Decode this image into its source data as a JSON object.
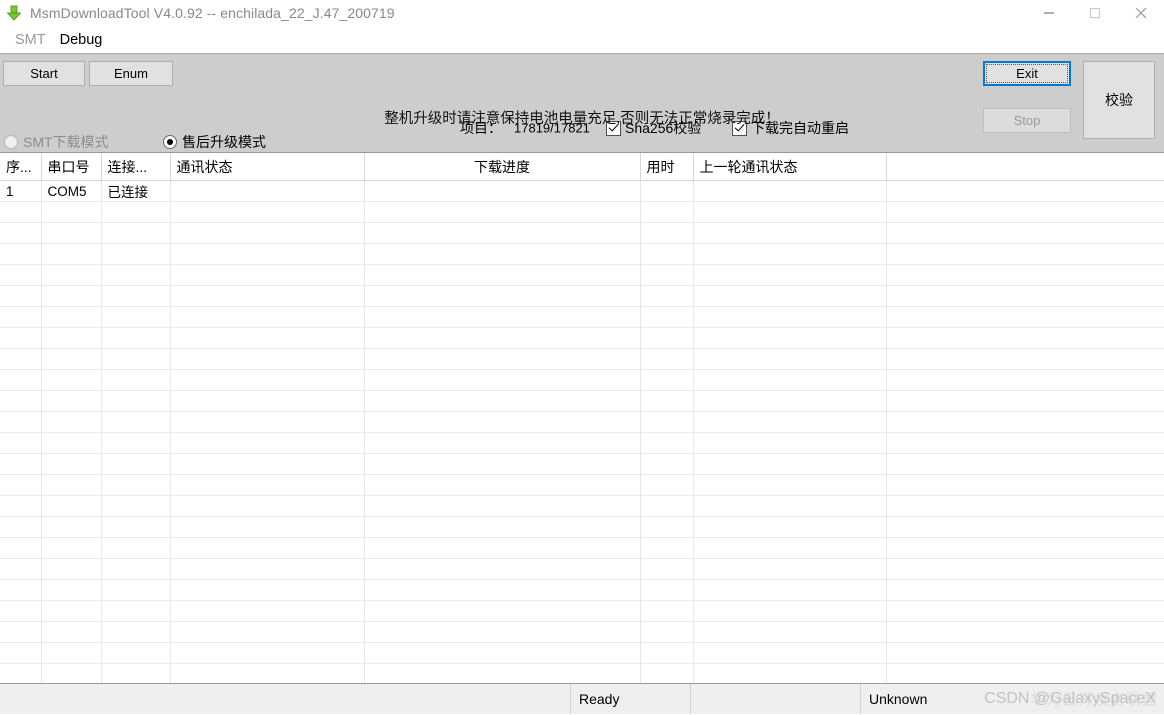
{
  "window": {
    "title": "MsmDownloadTool V4.0.92 -- enchilada_22_J.47_200719",
    "icon": "download-arrow-icon",
    "controls": {
      "minimize": "minimize-icon",
      "maximize": "maximize-icon",
      "close": "close-icon"
    }
  },
  "menubar": {
    "items": [
      {
        "label": "SMT",
        "enabled": false
      },
      {
        "label": "Debug",
        "enabled": true
      }
    ]
  },
  "toolbar": {
    "start_label": "Start",
    "enum_label": "Enum",
    "exit_label": "Exit",
    "stop_label": "Stop",
    "verify_label": "校验",
    "project_label": "项目：",
    "project_value": "17819/17821",
    "sha256_label": "Sha256校验",
    "sha256_checked": true,
    "auto_reboot_label": "下载完自动重启",
    "auto_reboot_checked": true,
    "warning_text": "整机升级时请注意保持电池电量充足,否则无法正常烧录完成！",
    "radio_smt_label": "SMT下载模式",
    "radio_smt_selected": false,
    "radio_smt_enabled": false,
    "radio_aftersale_label": "售后升级模式",
    "radio_aftersale_selected": true
  },
  "grid": {
    "columns": [
      {
        "key": "index",
        "label": "序...",
        "align": "left"
      },
      {
        "key": "port",
        "label": "串口号",
        "align": "left"
      },
      {
        "key": "connect",
        "label": "连接...",
        "align": "left"
      },
      {
        "key": "comm",
        "label": "通讯状态",
        "align": "left"
      },
      {
        "key": "progress",
        "label": "下载进度",
        "align": "center"
      },
      {
        "key": "elapsed",
        "label": "用时",
        "align": "left"
      },
      {
        "key": "lastcomm",
        "label": "上一轮通讯状态",
        "align": "left"
      },
      {
        "key": "extra",
        "label": "",
        "align": "left"
      }
    ],
    "rows": [
      {
        "index": "1",
        "port": "COM5",
        "connect": "已连接",
        "comm": "",
        "progress": "",
        "elapsed": "",
        "lastcomm": "",
        "extra": ""
      }
    ],
    "empty_row_count": 24
  },
  "statusbar": {
    "cells": [
      {
        "name": "status-message",
        "text": "Ready"
      },
      {
        "name": "status-blank",
        "text": ""
      },
      {
        "name": "status-device",
        "text": "Unknown"
      }
    ]
  },
  "watermark": {
    "text": "CSDN @GalaxySpaceX",
    "ghost_text": "华为云开发者联盟"
  }
}
